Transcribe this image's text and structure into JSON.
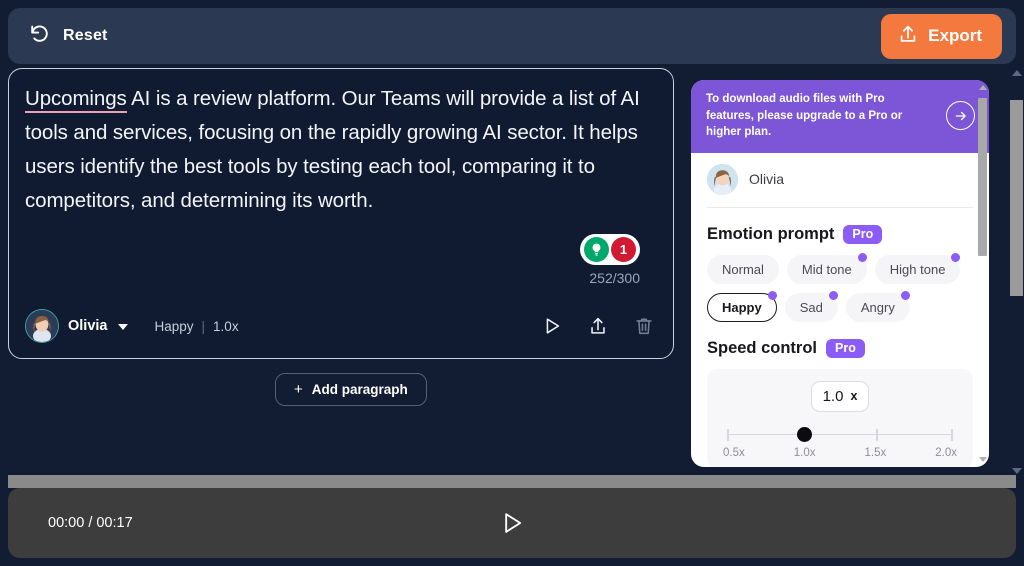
{
  "header": {
    "reset_label": "Reset",
    "export_label": "Export",
    "export_color": "#f4793f"
  },
  "editor": {
    "paragraph": {
      "misspelled_word": "Upcomings",
      "rest": " AI is a review platform. Our Teams will provide a list of AI tools and services, focusing on the rapidly growing AI sector. It helps users identify the best tools by testing each tool, comparing it to competitors, and determining its worth."
    },
    "hint_count": "1",
    "char_count": "252/300",
    "voice_name": "Olivia",
    "emotion": "Happy",
    "speed": "1.0x",
    "separator": "|",
    "actions": {
      "play": "play-icon",
      "share": "share-icon",
      "delete": "trash-icon"
    },
    "add_paragraph_label": "Add paragraph",
    "add_paragraph_plus": "+"
  },
  "right_panel": {
    "pro_banner": {
      "text": "To download audio files with Pro features, please upgrade to a Pro or higher plan.",
      "bg_color": "#7c56d6",
      "arrow_icon": "arrow-right-icon"
    },
    "speaker": {
      "name": "Olivia"
    },
    "emotion_section": {
      "title": "Emotion prompt",
      "pro_tag": "Pro",
      "chips": [
        {
          "label": "Normal",
          "pro": false,
          "selected": false
        },
        {
          "label": "Mid tone",
          "pro": true,
          "selected": false
        },
        {
          "label": "High tone",
          "pro": true,
          "selected": false
        },
        {
          "label": "Happy",
          "pro": true,
          "selected": true
        },
        {
          "label": "Sad",
          "pro": true,
          "selected": false
        },
        {
          "label": "Angry",
          "pro": true,
          "selected": false
        }
      ]
    },
    "speed_section": {
      "title": "Speed control",
      "pro_tag": "Pro",
      "value": "1.0",
      "unit": "x",
      "ticks": [
        "0.5x",
        "1.0x",
        "1.5x",
        "2.0x"
      ]
    }
  },
  "player": {
    "time": "00:00 / 00:17",
    "play_icon": "play-icon"
  }
}
